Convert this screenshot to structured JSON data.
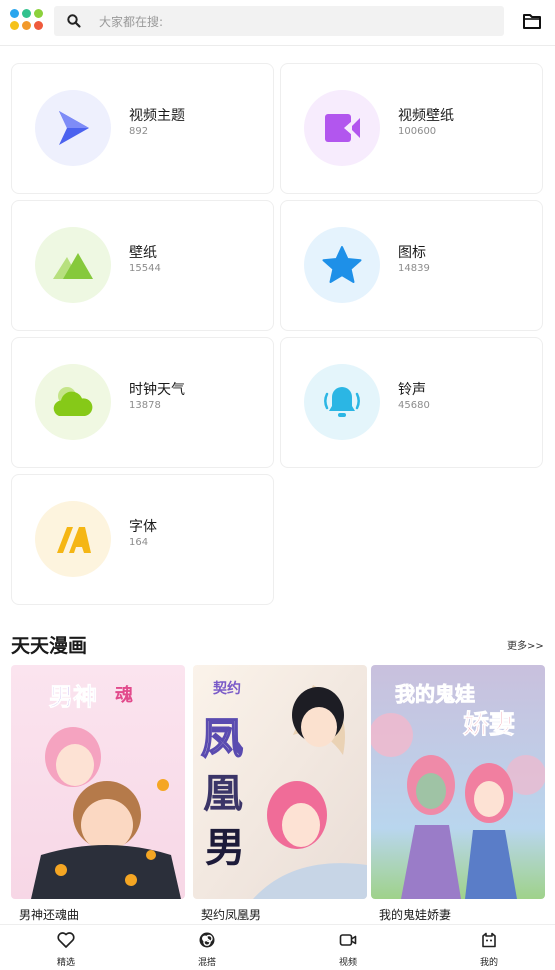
{
  "search": {
    "placeholder": "大家都在搜:"
  },
  "categories": [
    {
      "title": "视频主题",
      "count": "892",
      "icon": "play-icon",
      "bg": "#eef0fd",
      "color": "#5b6cf2"
    },
    {
      "title": "视频壁纸",
      "count": "100600",
      "icon": "video-icon",
      "bg": "#f7ecfd",
      "color": "#b256ee"
    },
    {
      "title": "壁纸",
      "count": "15544",
      "icon": "mountain-icon",
      "bg": "#eef8e2",
      "color": "#94d052"
    },
    {
      "title": "图标",
      "count": "14839",
      "icon": "star-icon",
      "bg": "#e5f3fd",
      "color": "#1e90e8"
    },
    {
      "title": "时钟天气",
      "count": "13878",
      "icon": "cloud-icon",
      "bg": "#f0f8e2",
      "color": "#86c918"
    },
    {
      "title": "铃声",
      "count": "45680",
      "icon": "bell-icon",
      "bg": "#e4f5fb",
      "color": "#2bb6e4"
    },
    {
      "title": "字体",
      "count": "164",
      "icon": "font-icon",
      "bg": "#fdf4de",
      "color": "#f5b614"
    }
  ],
  "comics_section": {
    "title": "天天漫画",
    "more": "更多>>",
    "items": [
      {
        "name": "男神还魂曲"
      },
      {
        "name": "契约凤凰男"
      },
      {
        "name": "我的鬼娃娇妻"
      }
    ]
  },
  "bottom_nav": [
    {
      "label": "精选",
      "icon": "heart-icon"
    },
    {
      "label": "混搭",
      "icon": "mix-icon"
    },
    {
      "label": "视频",
      "icon": "video-camera-icon"
    },
    {
      "label": "我的",
      "icon": "profile-icon"
    }
  ],
  "colors": {
    "logo": [
      "#2aa6ee",
      "#33c28e",
      "#8cd13c",
      "#f5c21b",
      "#f29a2b",
      "#ef5a3c"
    ]
  }
}
